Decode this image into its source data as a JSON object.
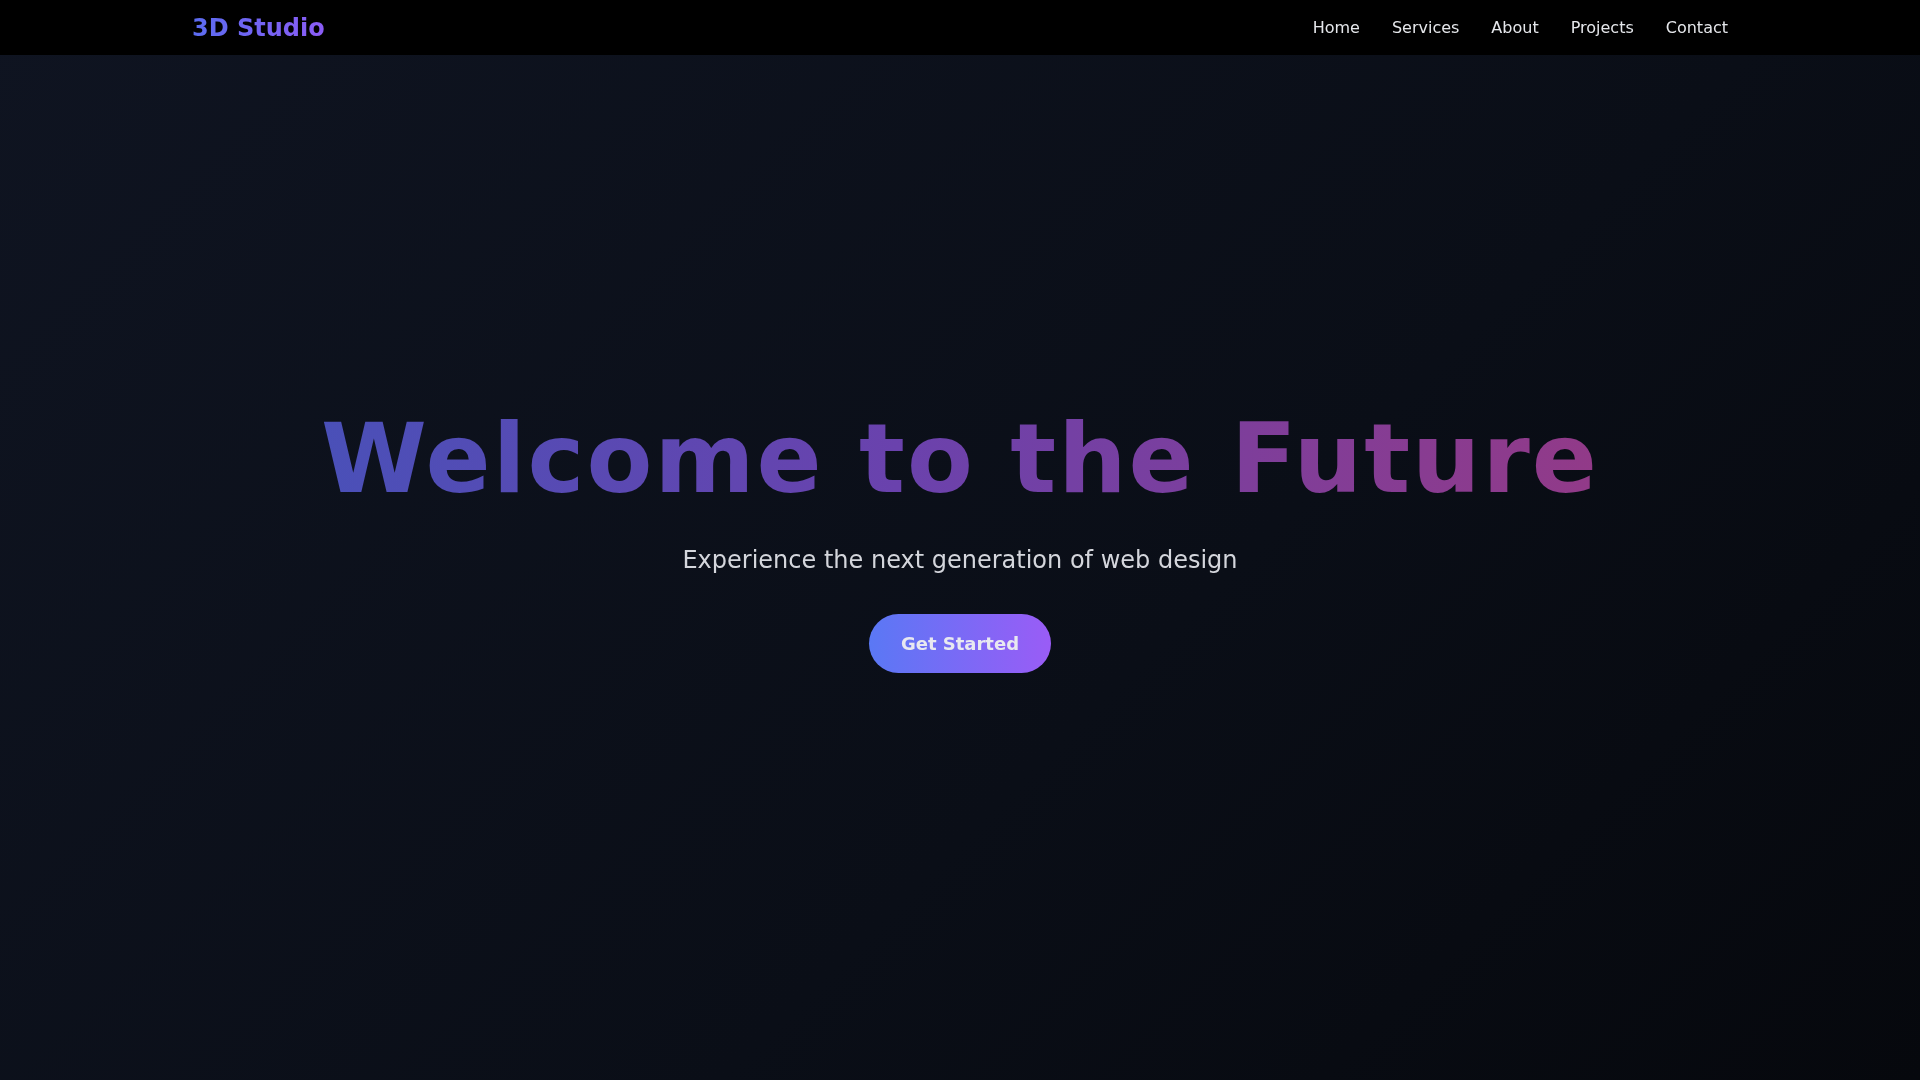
{
  "navbar": {
    "logo": "3D Studio",
    "links": [
      {
        "label": "Home"
      },
      {
        "label": "Services"
      },
      {
        "label": "About"
      },
      {
        "label": "Projects"
      },
      {
        "label": "Contact"
      }
    ]
  },
  "hero": {
    "title": "Welcome to the Future",
    "subtitle": "Experience the next generation of web design",
    "button": "Get Started"
  }
}
